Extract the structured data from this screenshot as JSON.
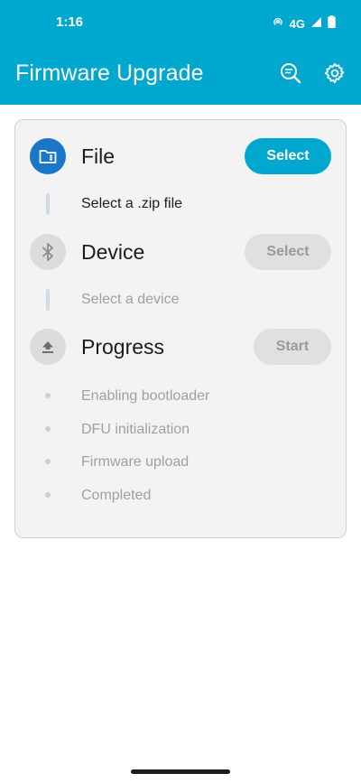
{
  "status_bar": {
    "time": "1:16",
    "network": "4G"
  },
  "app_bar": {
    "title": "Firmware Upgrade",
    "actions": [
      {
        "name": "scan-icon"
      },
      {
        "name": "gear-icon"
      }
    ],
    "color": "#00a7cf"
  },
  "file_section": {
    "title": "File",
    "button_label": "Select",
    "subtitle": "Select a .zip file",
    "icon": "folder-icon"
  },
  "device_section": {
    "title": "Device",
    "button_label": "Select",
    "subtitle": "Select a device",
    "icon": "bluetooth-icon"
  },
  "progress_section": {
    "title": "Progress",
    "button_label": "Start",
    "icon": "upload-icon",
    "steps": [
      "Enabling bootloader",
      "DFU initialization",
      "Firmware upload",
      "Completed"
    ]
  }
}
